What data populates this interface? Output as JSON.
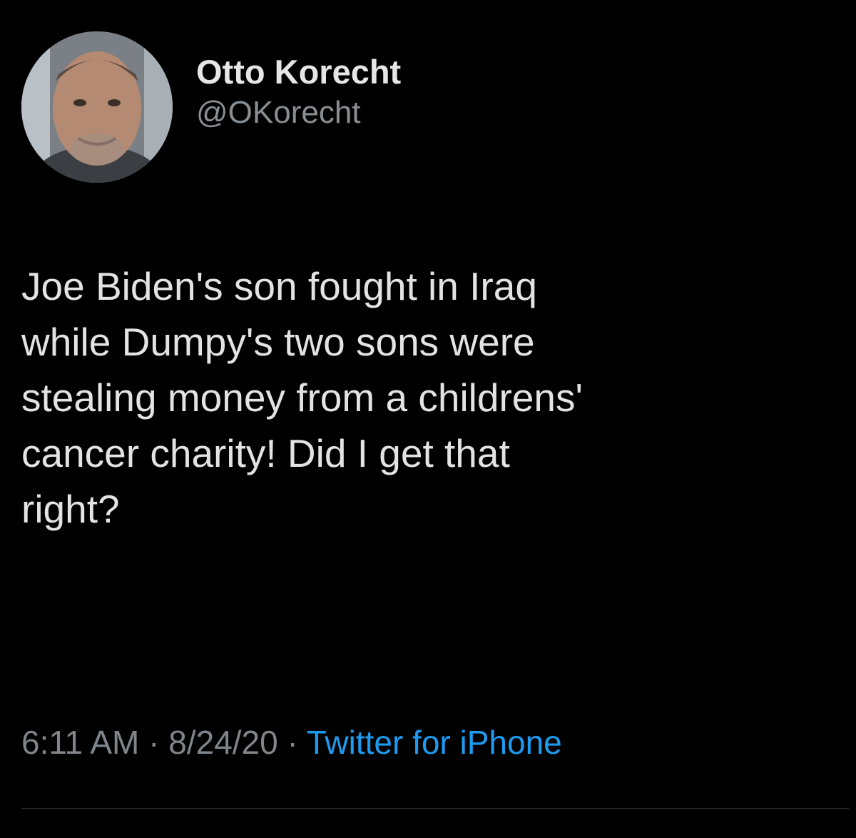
{
  "tweet": {
    "author": {
      "display_name": "Otto Korecht",
      "handle": "@OKorecht"
    },
    "text_lines": [
      "Joe Biden's son fought in Iraq",
      "while Dumpy's two sons were",
      "stealing money from a childrens'",
      "cancer charity! Did I get that",
      "right?"
    ],
    "time": "6:11 AM",
    "separator": "·",
    "date": "8/24/20",
    "source": "Twitter for iPhone"
  },
  "colors": {
    "background": "#000000",
    "text": "#e3e3e3",
    "secondary": "#7f858a",
    "link": "#1d9bf0"
  }
}
